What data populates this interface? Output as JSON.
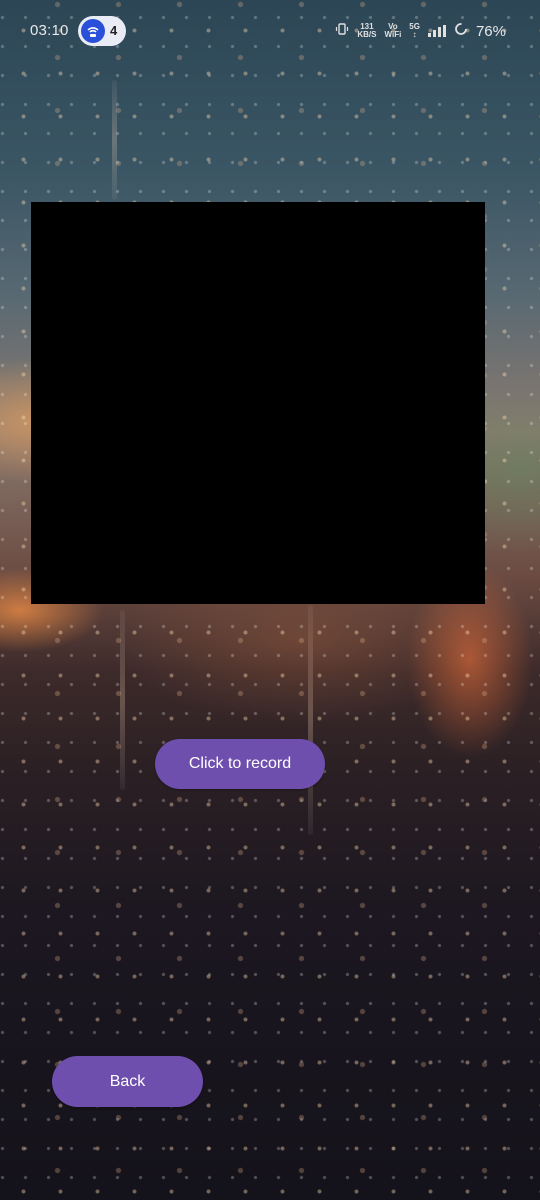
{
  "status_bar": {
    "time": "03:10",
    "hotspot_count": "4",
    "network_speed_value": "131",
    "network_speed_unit": "KB/S",
    "volte_top": "Vo",
    "volte_bottom": "WiFi",
    "network_type": "5G",
    "battery_percent": "76%",
    "icons": [
      "hotspot-icon",
      "vibrate-icon",
      "signal-icon",
      "battery-icon"
    ]
  },
  "camera": {
    "record_label": "Click to record"
  },
  "navigation": {
    "back_label": "Back"
  },
  "colors": {
    "button": "#6e4fae",
    "preview": "#000000",
    "hotspot": "#2a4fd8"
  }
}
